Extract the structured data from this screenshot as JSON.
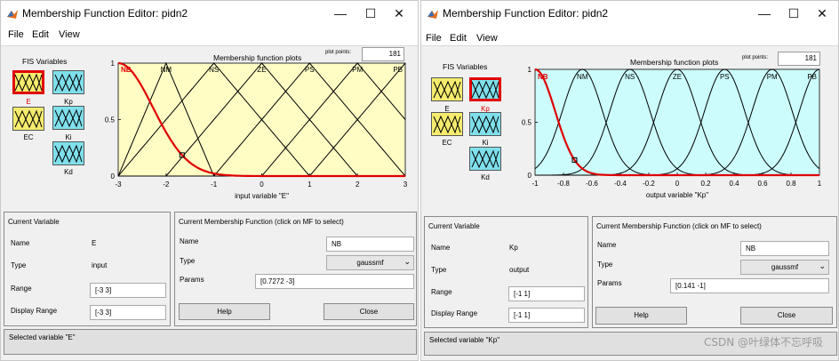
{
  "windows": [
    {
      "title": "Membership Function Editor: pidn2",
      "menu": [
        "File",
        "Edit",
        "View"
      ],
      "fis_label": "FIS Variables",
      "inputs": [
        "E",
        "EC"
      ],
      "outputs": [
        "Kp",
        "Ki",
        "Kd"
      ],
      "selected_variable": "E",
      "plot_title": "Membership function plots",
      "plot_points_label": "plot points:",
      "plot_points_value": "181",
      "x_label": "input variable \"E\"",
      "mf_labels": [
        "NB",
        "NM",
        "NS",
        "ZE",
        "PS",
        "PM",
        "PB"
      ],
      "x_ticks": [
        "-3",
        "-2",
        "-1",
        "0",
        "1",
        "2",
        "3"
      ],
      "y_ticks": [
        "1",
        "0.5",
        "0"
      ],
      "current_var": {
        "title": "Current Variable",
        "name_label": "Name",
        "name": "E",
        "type_label": "Type",
        "type": "input",
        "range_label": "Range",
        "range": "[-3 3]",
        "display_range_label": "Display Range",
        "display_range": "[-3 3]"
      },
      "current_mf": {
        "title": "Current Membership Function (click on MF to select)",
        "name_label": "Name",
        "name": "NB",
        "type_label": "Type",
        "type": "gaussmf",
        "params_label": "Params",
        "params": "[0.7272 -3]"
      },
      "help_label": "Help",
      "close_label": "Close",
      "status": "Selected variable \"E\""
    },
    {
      "title": "Membership Function Editor: pidn2",
      "menu": [
        "File",
        "Edit",
        "View"
      ],
      "fis_label": "FIS Variables",
      "inputs": [
        "E",
        "EC"
      ],
      "outputs": [
        "Kp",
        "Ki",
        "Kd"
      ],
      "selected_variable": "Kp",
      "plot_title": "Membership function plots",
      "plot_points_label": "plot points:",
      "plot_points_value": "181",
      "x_label": "output variable \"Kp\"",
      "mf_labels": [
        "NB",
        "NM",
        "NS",
        "ZE",
        "PS",
        "PM",
        "PB"
      ],
      "x_ticks": [
        "-1",
        "-0.8",
        "-0.6",
        "-0.4",
        "-0.2",
        "0",
        "0.2",
        "0.4",
        "0.6",
        "0.8",
        "1"
      ],
      "y_ticks": [
        "1",
        "0.5",
        "0"
      ],
      "current_var": {
        "title": "Current Variable",
        "name_label": "Name",
        "name": "Kp",
        "type_label": "Type",
        "type": "output",
        "range_label": "Range",
        "range": "[-1 1]",
        "display_range_label": "Display Range",
        "display_range": "[-1 1]"
      },
      "current_mf": {
        "title": "Current Membership Function (click on MF to select)",
        "name_label": "Name",
        "name": "NB",
        "type_label": "Type",
        "type": "gaussmf",
        "params_label": "Params",
        "params": "[0.141 -1]"
      },
      "help_label": "Help",
      "close_label": "Close",
      "status": "Selected variable \"Kp\""
    }
  ],
  "watermark": "CSDN @叶绿体不忘呼吸",
  "colors": {
    "input_fill": "#f5ec6e",
    "output_fill": "#7fe0ec",
    "plot_bg_input": "#fffcc4",
    "plot_bg_output": "#ccfcfc",
    "selected_mf": "#e00000"
  },
  "chart_data": [
    {
      "type": "line",
      "title": "Membership function plots",
      "xlabel": "input variable \"E\"",
      "xlim": [
        -3,
        3
      ],
      "ylim": [
        0,
        1
      ],
      "series": [
        {
          "name": "NB",
          "shape": "gaussmf",
          "params": [
            0.7272,
            -3
          ],
          "selected": true
        },
        {
          "name": "NM",
          "shape": "trimf",
          "params": [
            -3,
            -2,
            -1
          ]
        },
        {
          "name": "NS",
          "shape": "trimf",
          "params": [
            -3,
            -1,
            1
          ]
        },
        {
          "name": "ZE",
          "shape": "trimf",
          "params": [
            -2,
            0,
            2
          ]
        },
        {
          "name": "PS",
          "shape": "trimf",
          "params": [
            -1,
            1,
            3
          ]
        },
        {
          "name": "PM",
          "shape": "trimf",
          "params": [
            0,
            2,
            4
          ]
        },
        {
          "name": "PB",
          "shape": "trimf",
          "params": [
            1,
            3,
            5
          ]
        }
      ]
    },
    {
      "type": "line",
      "title": "Membership function plots",
      "xlabel": "output variable \"Kp\"",
      "xlim": [
        -1,
        1
      ],
      "ylim": [
        0,
        1
      ],
      "series": [
        {
          "name": "NB",
          "shape": "gaussmf",
          "params": [
            0.141,
            -1
          ],
          "selected": true
        },
        {
          "name": "NM",
          "shape": "gaussmf",
          "params": [
            0.141,
            -0.667
          ]
        },
        {
          "name": "NS",
          "shape": "gaussmf",
          "params": [
            0.141,
            -0.333
          ]
        },
        {
          "name": "ZE",
          "shape": "gaussmf",
          "params": [
            0.141,
            0
          ]
        },
        {
          "name": "PS",
          "shape": "gaussmf",
          "params": [
            0.141,
            0.333
          ]
        },
        {
          "name": "PM",
          "shape": "gaussmf",
          "params": [
            0.141,
            0.667
          ]
        },
        {
          "name": "PB",
          "shape": "gaussmf",
          "params": [
            0.141,
            1
          ]
        }
      ]
    }
  ]
}
